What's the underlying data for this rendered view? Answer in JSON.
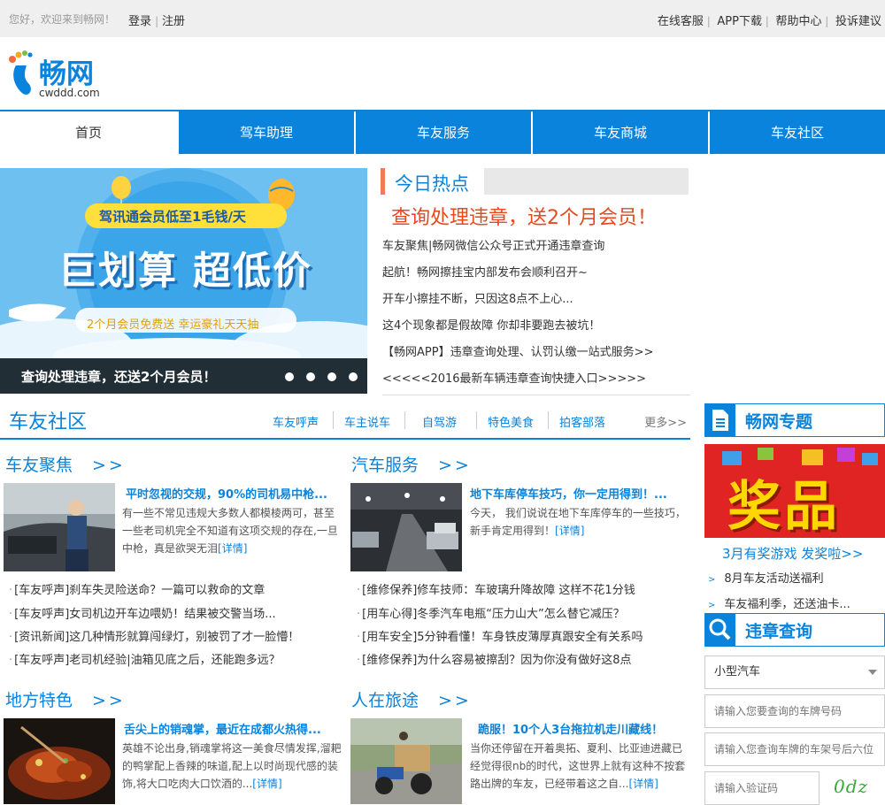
{
  "topbar": {
    "welcome": "您好，欢迎来到畅网！",
    "login": "登录",
    "register": "注册",
    "links": [
      "在线客服",
      "APP下载",
      "帮助中心",
      "投诉建议"
    ]
  },
  "logo": {
    "brand": "畅网",
    "domain": "cwddd.com"
  },
  "nav": [
    "首页",
    "驾车助理",
    "车友服务",
    "车友商城",
    "车友社区"
  ],
  "banner": {
    "badge": "驾讯通会员低至1毛钱/天",
    "headline": "巨划算 超低价",
    "ribbon": "2个月会员免费送  幸运豪礼天天抽",
    "caption": "查询处理违章，还送2个月会员！"
  },
  "hot": {
    "title": "今日热点",
    "headline": "查询处理违章，送2个月会员！",
    "items": [
      "车友聚焦|畅网微信公众号正式开通违章查询",
      "起航！畅网擦挂宝内部发布会顺利召开~",
      "开车小擦挂不断，只因这8点不上心...",
      "这4个现象都是假故障 你却非要跑去被坑！",
      "【畅网APP】违章查询处理、认罚认缴一站式服务>>",
      "<<<<<2016最新车辆违章查询快捷入口>>>>>"
    ]
  },
  "community": {
    "title": "车友社区",
    "tabs": [
      "车友呼声",
      "车主说车",
      "自驾游",
      "特色美食",
      "拍客部落"
    ],
    "more": "更多>>"
  },
  "sections": {
    "focus": {
      "title": "车友聚焦",
      "arrow": ">>",
      "lead_title": "平时忽视的交规，90%的司机易中枪...",
      "lead_desc": "有一些不常见违规大多数人都模棱两可，甚至一些老司机完全不知道有这项交规的存在,一旦中枪，真是欲哭无泪",
      "detail": "[详情]",
      "items": [
        "[车友呼声]刹车失灵险送命？一篇可以救命的文章",
        "[车友呼声]女司机边开车边喂奶！结果被交警当场...",
        "[资讯新闻]这几种情形就算闯绿灯，别被罚了才一脸懵！",
        "[车友呼声]老司机经验|油箱见底之后，还能跑多远？"
      ]
    },
    "service": {
      "title": "汽车服务",
      "arrow": ">>",
      "lead_title": "地下车库停车技巧，你一定用得到！...",
      "lead_desc": "今天， 我们说说在地下车库停车的一些技巧，新手肯定用得到！",
      "detail": "[详情]",
      "items": [
        "[维修保养]修车技师：车玻璃升降故障 这样不花1分钱",
        "[用车心得]冬季汽车电瓶“压力山大”怎么替它减压？",
        "[用车安全]5分钟看懂！车身铁皮薄厚真跟安全有关系吗",
        "[维修保养]为什么容易被擦刮？因为你没有做好这8点"
      ]
    },
    "local": {
      "title": "地方特色",
      "arrow": ">>",
      "lead_title": "舌尖上的销魂掌，最近在成都火热得...",
      "lead_desc": "英雄不论出身,销魂掌将这一美食尽情发挥,溜耙的鸭掌配上香辣的味道,配上以时尚现代感的装饰,将大口吃肉大口饮酒的...",
      "detail": "[详情]"
    },
    "travel": {
      "title": "人在旅途",
      "arrow": ">>",
      "lead_title": "跪服！10个人3台拖拉机走川藏线！",
      "lead_desc": "当你还停留在开着奥拓、夏利、比亚迪进藏已经觉得很nb的时代，这世界上就有这种不按套路出牌的车友，已经带着这之自...",
      "detail": "[详情]"
    }
  },
  "sidebar": {
    "special_title": "畅网专题",
    "prize_text": "奖品",
    "promo_link": "3月有奖游戏 发奖啦>>",
    "promo_items": [
      "8月车友活动送福利",
      "车友福利季，还送油卡..."
    ],
    "query_title": "违章查询",
    "vehicle_type": "小型汽车",
    "plate_placeholder": "请输入您要查询的车牌号码",
    "vin_placeholder": "请输入您查询车牌的车架号后六位",
    "captcha_placeholder": "请输入验证码",
    "captcha_text": "0dz"
  }
}
